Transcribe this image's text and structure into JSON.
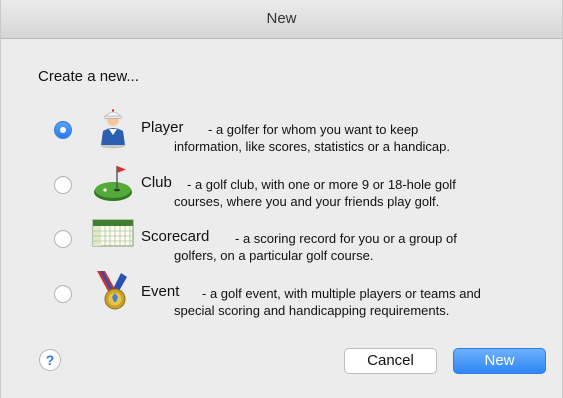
{
  "window": {
    "title": "New"
  },
  "prompt": "Create a new...",
  "options": [
    {
      "name": "Player",
      "desc_line1": "- a golfer for whom you want to keep",
      "desc_line2": "information, like scores, statistics or a handicap.",
      "icon": "golfer-icon",
      "selected": true
    },
    {
      "name": "Club",
      "desc_line1": "- a golf club, with one or more 9 or 18-hole golf",
      "desc_line2": "courses, where you and your friends play golf.",
      "icon": "golf-green-flag-icon",
      "selected": false
    },
    {
      "name": "Scorecard",
      "desc_line1": "- a scoring record for you or a group of",
      "desc_line2": "golfers, on a particular golf course.",
      "icon": "scorecard-icon",
      "selected": false
    },
    {
      "name": "Event",
      "desc_line1": "- a golf event, with multiple players or teams and",
      "desc_line2": "special scoring and handicapping requirements.",
      "icon": "medal-icon",
      "selected": false
    }
  ],
  "buttons": {
    "help_label": "?",
    "cancel_label": "Cancel",
    "new_label": "New"
  },
  "colors": {
    "accent": "#2f86f6",
    "window_bg": "#ececec"
  }
}
